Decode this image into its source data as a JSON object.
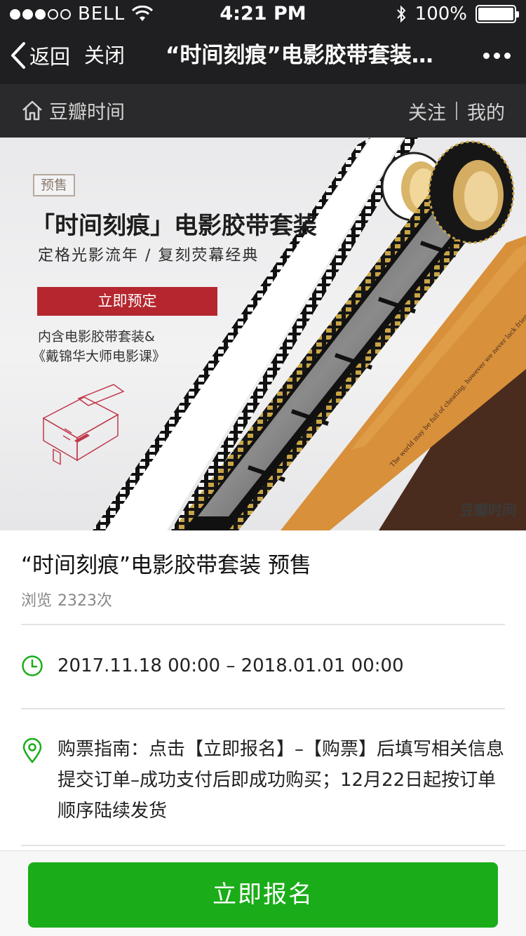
{
  "status_bar": {
    "carrier": "BELL",
    "time": "4:21 PM",
    "battery": "100%",
    "battery_level": 1.0
  },
  "nav": {
    "back_label": "返回",
    "close_label": "关闭",
    "title": "“时间刻痕”电影胶带套装预售",
    "more_icon": "more-dots-icon"
  },
  "douban_bar": {
    "home_label": "豆瓣时间",
    "follow_label": "关注",
    "mine_label": "我的"
  },
  "banner": {
    "badge": "预售",
    "title": "「时间刻痕」电影胶带套装",
    "subtitle": "定格光影流年 / 复刻荧幕经典",
    "button_label": "立即预定",
    "desc_line1": "内含电影胶带套装&",
    "desc_line2": "《戴锦华大师电影课》",
    "brand": "豆瓣时间",
    "tape_text": "The world may be full of cheating, however we never lack friends with a warm heart"
  },
  "event": {
    "title": "“时间刻痕”电影胶带套装 预售",
    "views_label": "浏览",
    "views_count": "2323次",
    "time_range": "2017.11.18 00:00 – 2018.01.01 00:00",
    "guide": "购票指南：点击【立即报名】–【购票】后填写相关信息提交订单–成功支付后即成功购买；12月22日起按订单顺序陆续发货"
  },
  "cta": {
    "label": "立即报名"
  },
  "colors": {
    "header_bg": "#1f1f21",
    "accent_green": "#1aad19",
    "banner_red": "#b5262e"
  }
}
